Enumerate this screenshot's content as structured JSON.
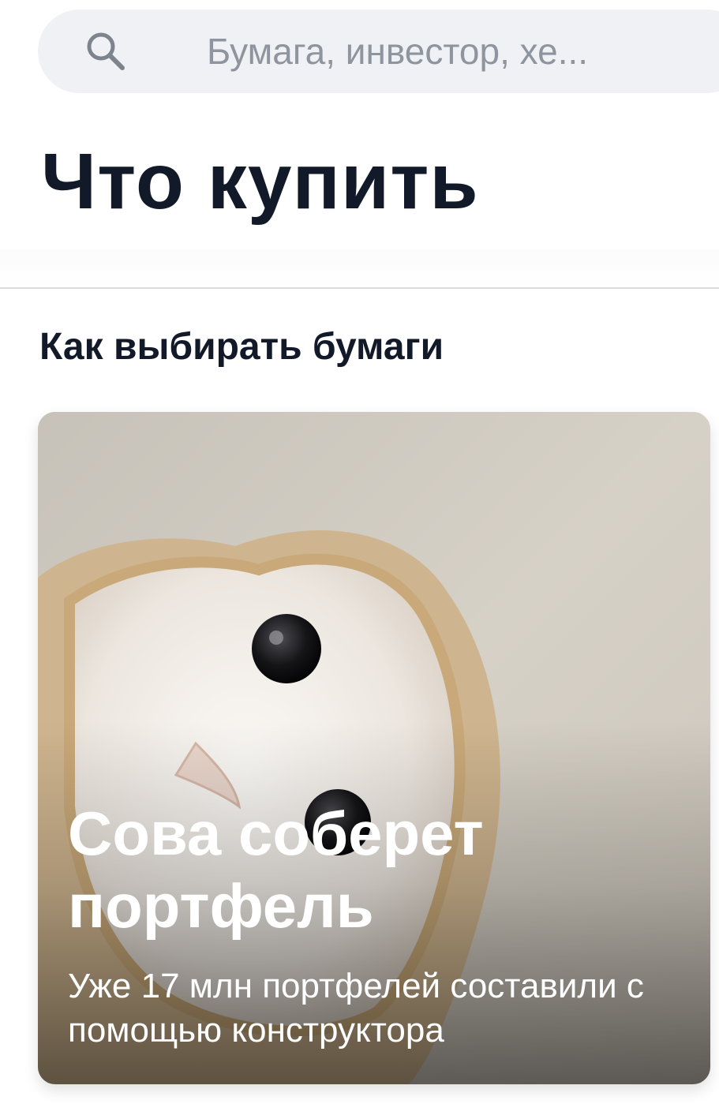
{
  "search": {
    "placeholder": "Бумага, инвестор, хе...",
    "icon": "search-icon"
  },
  "page": {
    "title": "Что купить"
  },
  "section": {
    "heading": "Как выбирать бумаги"
  },
  "promo_card": {
    "title": "Сова соберет портфель",
    "subtitle": "Уже 17 млн портфелей составили с помощью конструктора",
    "image": "barn-owl-photo"
  },
  "colors": {
    "search_background": "#eff1f4",
    "title_text": "#121a2a",
    "placeholder_text": "#8f959e",
    "card_text": "#ffffff"
  }
}
